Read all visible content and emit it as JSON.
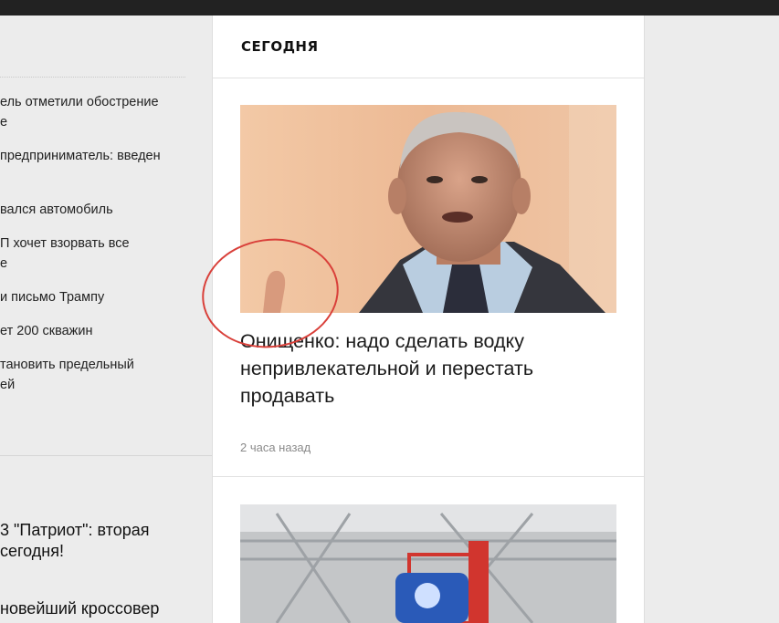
{
  "left_column": {
    "links": [
      {
        "line1": "ель отметили обострение",
        "line2": "е"
      },
      {
        "line1": "предприниматель: введен",
        "line2": ""
      },
      {
        "line1": "вался автомобиль",
        "line2": ""
      },
      {
        "line1": "П хочет взорвать все",
        "line2": "е"
      },
      {
        "line1": "и письмо Трампу",
        "line2": ""
      },
      {
        "line1": "ет 200 скважин",
        "line2": ""
      },
      {
        "line1": "тановить предельный",
        "line2": "ей"
      }
    ],
    "featured": [
      {
        "line1": "3 \"Патриот\": вторая",
        "line2": "сегодня!"
      },
      {
        "line1": "новейший кроссовер",
        "line2": ""
      }
    ]
  },
  "main": {
    "section_title": "СЕГОДНЯ",
    "articles": [
      {
        "title": "Онищенко: надо сделать водку непривлекательной и перестать продавать",
        "time": "2 часа назад"
      }
    ]
  },
  "colors": {
    "topbar": "#222222",
    "page_bg": "#ececec",
    "annotation": "#d9403a"
  }
}
